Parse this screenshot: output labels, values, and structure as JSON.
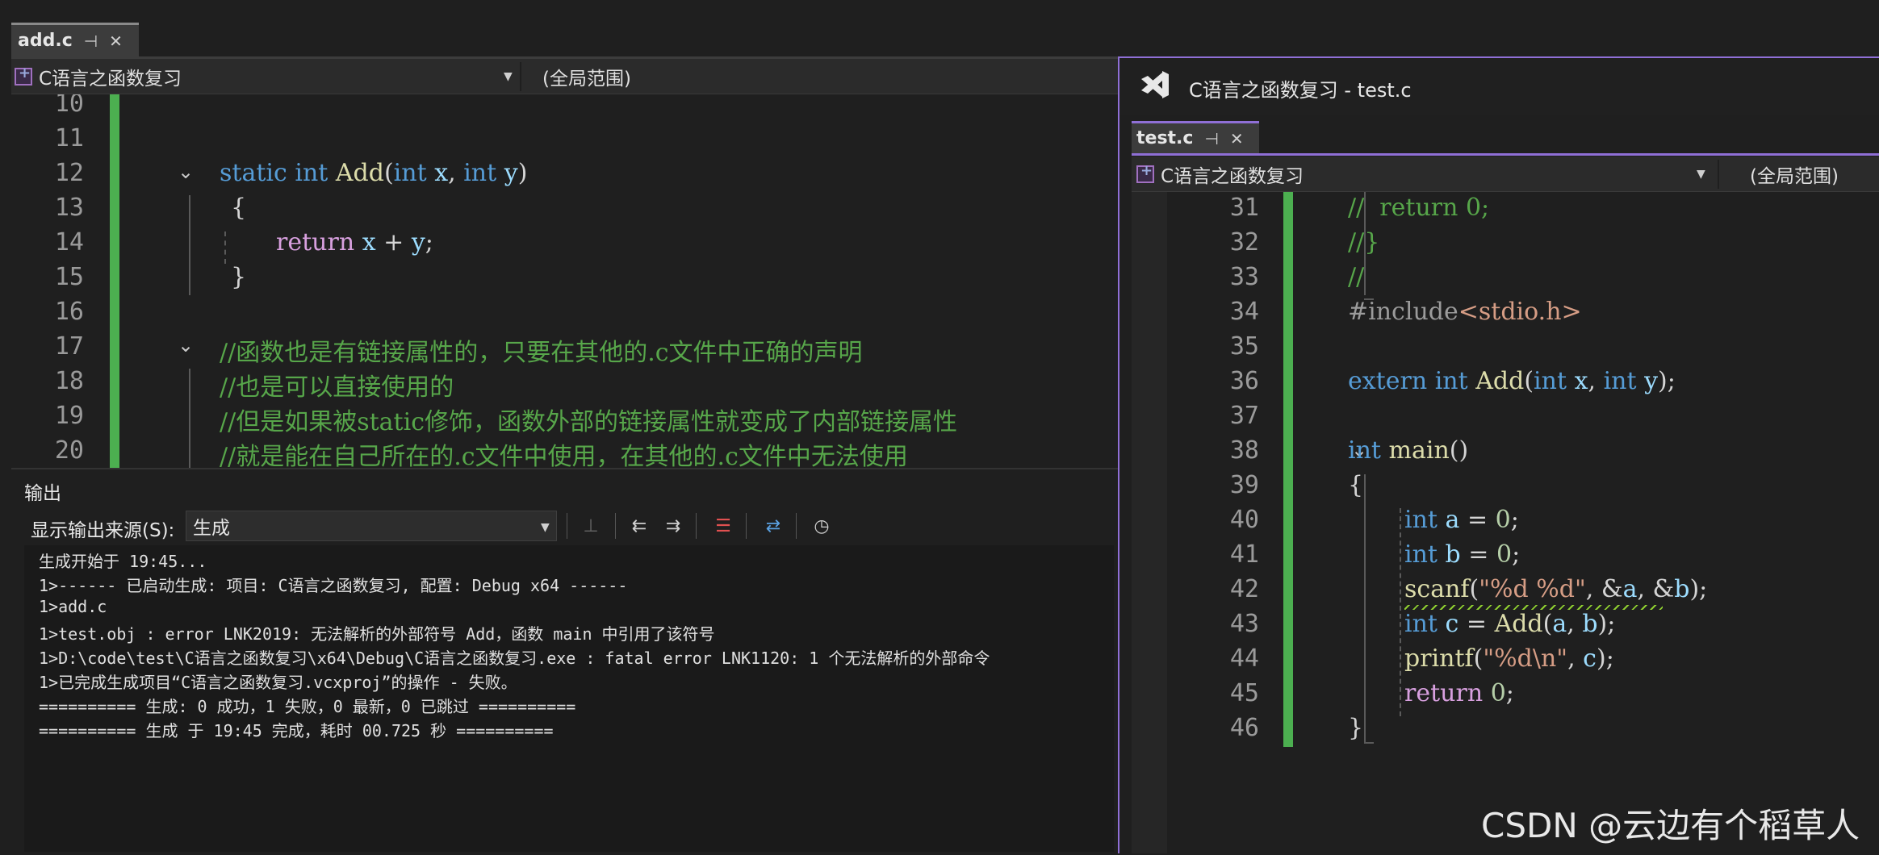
{
  "left_editor": {
    "tab": {
      "title": "add.c",
      "pin_icon": "pin-icon",
      "close_icon": "close-icon"
    },
    "navbar": {
      "project": "C语言之函数复习",
      "scope": "(全局范围)"
    },
    "lines": [
      {
        "num": "10",
        "code": ""
      },
      {
        "num": "11",
        "code": ""
      },
      {
        "num": "12",
        "code": "static int Add(int x, int y)"
      },
      {
        "num": "13",
        "code": "{"
      },
      {
        "num": "14",
        "code": "return x + y;"
      },
      {
        "num": "15",
        "code": "}"
      },
      {
        "num": "16",
        "code": ""
      },
      {
        "num": "17",
        "code": "//函数也是有链接属性的，只要在其他的.c文件中正确的声明"
      },
      {
        "num": "18",
        "code": "//也是可以直接使用的"
      },
      {
        "num": "19",
        "code": "//但是如果被static修饰，函数外部的链接属性就变成了内部链接属性"
      },
      {
        "num": "20",
        "code": "//就是能在自己所在的.c文件中使用，在其他的.c文件中无法使用"
      }
    ]
  },
  "output": {
    "title": "输出",
    "source_label": "显示输出来源(S):",
    "source_value": "生成",
    "lines": [
      "生成开始于 19:45...",
      "1>------ 已启动生成: 项目: C语言之函数复习, 配置: Debug x64 ------",
      "1>add.c",
      "1>test.obj : error LNK2019: 无法解析的外部符号 Add，函数 main 中引用了该符号",
      "1>D:\\code\\test\\C语言之函数复习\\x64\\Debug\\C语言之函数复习.exe : fatal error LNK1120: 1 个无法解析的外部命令",
      "1>已完成生成项目“C语言之函数复习.vcxproj”的操作 - 失败。",
      "========== 生成: 0 成功，1 失败，0 最新，0 已跳过 ==========",
      "========== 生成 于 19:45 完成，耗时 00.725 秒 =========="
    ]
  },
  "right_window": {
    "title": "C语言之函数复习 - test.c",
    "tab": {
      "title": "test.c"
    },
    "navbar": {
      "project": "C语言之函数复习",
      "scope": "(全局范围)"
    },
    "lines": [
      {
        "num": "31",
        "code": "//  return 0;"
      },
      {
        "num": "32",
        "code": "//}"
      },
      {
        "num": "33",
        "code": "//"
      },
      {
        "num": "34",
        "code": "#include<stdio.h>"
      },
      {
        "num": "35",
        "code": ""
      },
      {
        "num": "36",
        "code": "extern int Add(int x, int y);"
      },
      {
        "num": "37",
        "code": ""
      },
      {
        "num": "38",
        "code": "int main()"
      },
      {
        "num": "39",
        "code": "{"
      },
      {
        "num": "40",
        "code": "int a = 0;"
      },
      {
        "num": "41",
        "code": "int b = 0;"
      },
      {
        "num": "42",
        "code": "scanf(\"%d %d\", &a, &b);"
      },
      {
        "num": "43",
        "code": "int c = Add(a, b);"
      },
      {
        "num": "44",
        "code": "printf(\"%d\\n\", c);"
      },
      {
        "num": "45",
        "code": "return 0;"
      },
      {
        "num": "46",
        "code": "}"
      }
    ]
  },
  "watermark": "CSDN @云边有个稻草人",
  "colors": {
    "accent": "#8f6fd6",
    "changebar": "#4caf50",
    "keyword": "#569cd6",
    "comment": "#57a64a",
    "function": "#dcdcaa"
  }
}
